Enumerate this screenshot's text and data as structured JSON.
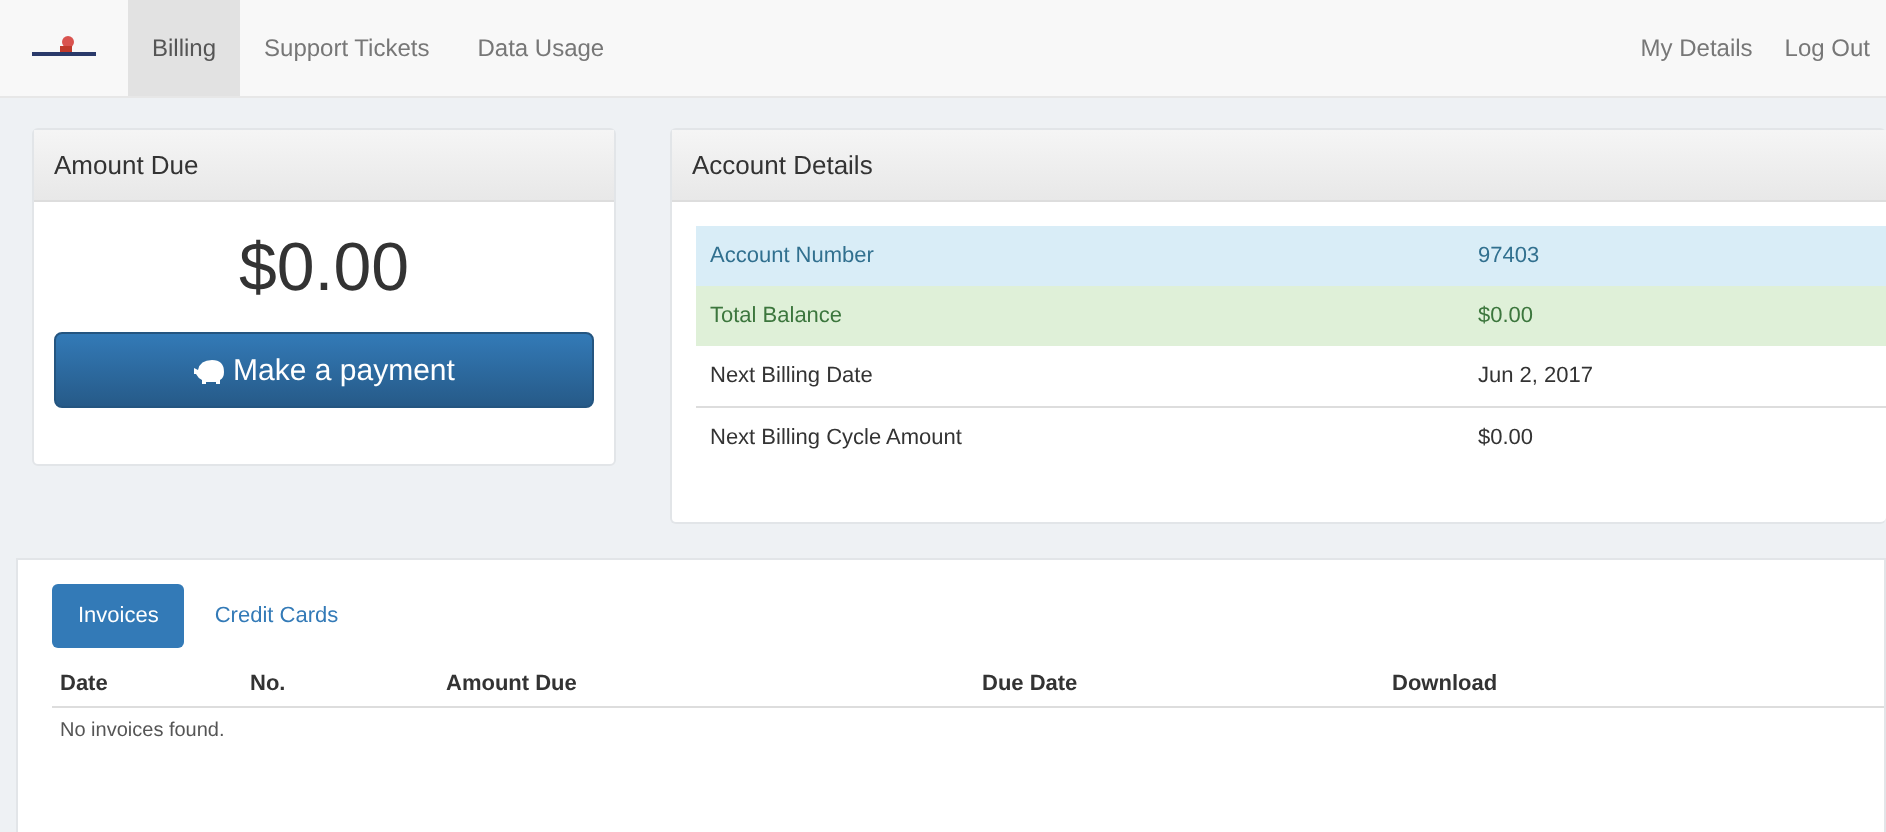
{
  "nav": {
    "tabs": [
      {
        "label": "Billing",
        "selected": true
      },
      {
        "label": "Support Tickets",
        "selected": false
      },
      {
        "label": "Data Usage",
        "selected": false
      }
    ],
    "right_links": [
      "My Details",
      "Log Out"
    ]
  },
  "amount_due": {
    "title": "Amount Due",
    "amount": "$0.00",
    "button": "Make a payment"
  },
  "account_details": {
    "title": "Account Details",
    "rows": [
      {
        "label": "Account Number",
        "value": "97403",
        "kind": "info"
      },
      {
        "label": "Total Balance",
        "value": "$0.00",
        "kind": "success"
      },
      {
        "label": "Next Billing Date",
        "value": "Jun 2, 2017",
        "kind": "plain"
      },
      {
        "label": "Next Billing Cycle Amount",
        "value": "$0.00",
        "kind": "plain"
      }
    ]
  },
  "billing_tabs": [
    {
      "label": "Invoices",
      "selected": true
    },
    {
      "label": "Credit Cards",
      "selected": false
    }
  ],
  "table": {
    "columns": [
      "Date",
      "No.",
      "Amount Due",
      "Due Date",
      "Download"
    ],
    "empty_message": "No invoices found."
  }
}
